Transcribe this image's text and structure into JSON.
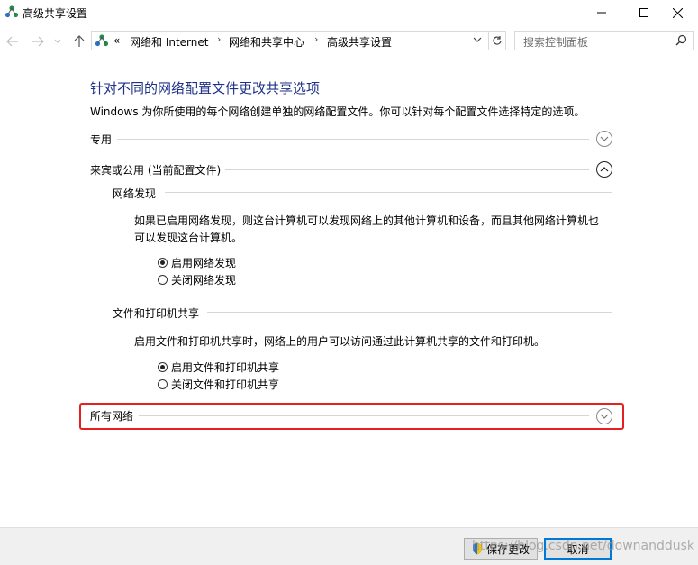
{
  "window": {
    "title": "高级共享设置",
    "minimize_icon": "minimize-icon",
    "maximize_icon": "maximize-icon",
    "close_icon": "close-icon"
  },
  "address_bar": {
    "overflow": "«",
    "breadcrumbs": [
      "网络和 Internet",
      "网络和共享中心",
      "高级共享设置"
    ],
    "separator": "›",
    "search_placeholder": "搜索控制面板"
  },
  "main": {
    "heading": "针对不同的网络配置文件更改共享选项",
    "description": "Windows 为你所使用的每个网络创建单独的网络配置文件。你可以针对每个配置文件选择特定的选项。",
    "profiles": [
      {
        "label": "专用",
        "state": "collapsed"
      },
      {
        "label": "来宾或公用 (当前配置文件)",
        "state": "expanded"
      },
      {
        "label": "所有网络",
        "state": "collapsed"
      }
    ],
    "network_discovery": {
      "title": "网络发现",
      "description": "如果已启用网络发现，则这台计算机可以发现网络上的其他计算机和设备，而且其他网络计算机也可以发现这台计算机。",
      "options": [
        {
          "label": "启用网络发现",
          "checked": true
        },
        {
          "label": "关闭网络发现",
          "checked": false
        }
      ]
    },
    "file_printer_sharing": {
      "title": "文件和打印机共享",
      "description": "启用文件和打印机共享时，网络上的用户可以访问通过此计算机共享的文件和打印机。",
      "options": [
        {
          "label": "启用文件和打印机共享",
          "checked": true
        },
        {
          "label": "关闭文件和打印机共享",
          "checked": false
        }
      ]
    }
  },
  "footer": {
    "save_label": "保存更改",
    "cancel_label": "取消"
  },
  "watermark": "https://blog.csdn.net/downanddusk",
  "colors": {
    "heading": "#1e3287",
    "highlight": "#e62020",
    "primary_button_border": "#0078d7"
  }
}
